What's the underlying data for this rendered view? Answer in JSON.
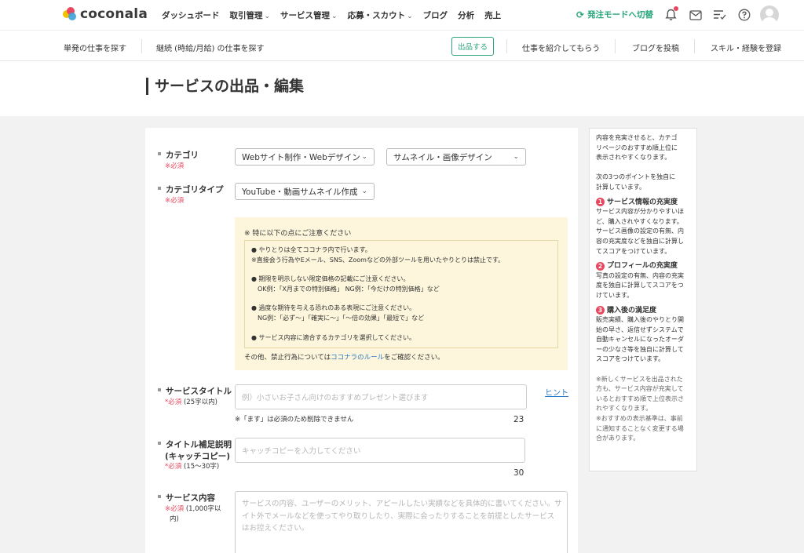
{
  "brand": {
    "name": "coconala"
  },
  "topnav": {
    "menu": [
      {
        "label": "ダッシュボード",
        "dropdown": false
      },
      {
        "label": "取引管理",
        "dropdown": true
      },
      {
        "label": "サービス管理",
        "dropdown": true
      },
      {
        "label": "応募・スカウト",
        "dropdown": true
      },
      {
        "label": "ブログ",
        "dropdown": false
      },
      {
        "label": "分析",
        "dropdown": false
      },
      {
        "label": "売上",
        "dropdown": false
      }
    ],
    "chevron": "⌄",
    "mode_switch": "発注モードへ切替",
    "icons": [
      "bell-icon",
      "mail-icon",
      "checklist-icon",
      "help-icon",
      "avatar"
    ],
    "accent_color": "#2aa57c",
    "badge_color": "#e9475f"
  },
  "subnav": {
    "left_links": [
      "単発の仕事を探す",
      "継続 (時給/月給) の仕事を探す"
    ],
    "publish_button": "出品する",
    "right_links": [
      "仕事を紹介してもらう",
      "ブログを投稿",
      "スキル・経験を登録"
    ]
  },
  "page": {
    "title": "サービスの出品・編集"
  },
  "form": {
    "category": {
      "label": "カテゴリ",
      "required": "※必須",
      "value1": "Webサイト制作・Webデザイン",
      "value2": "サムネイル・画像デザイン"
    },
    "category_type": {
      "label": "カテゴリタイプ",
      "required": "※必須",
      "value": "YouTube・動画サムネイル作成"
    },
    "notice": {
      "heading": "※ 特に以下の点にご注意ください",
      "lines": [
        "● やりとりは全てココナラ内で行います。",
        "※直接会う行為やEメール、SNS、Zoomなどの外部ツールを用いたやりとりは禁止です。",
        "● 期限を明示しない限定価格の記載にご注意ください。",
        "OK例：「X月までの特別価格」 NG例：「今だけの特別価格」など",
        "● 過度な期待を与える恐れのある表現にご注意ください。",
        "NG例：「必ず〜」「確実に〜」「〜倍の効果」「最短で」など",
        "● サービス内容に適合するカテゴリを選択してください。"
      ],
      "footer_prefix": "その他、禁止行為については",
      "footer_link": "ココナラのルール",
      "footer_suffix": "をご確認ください。"
    },
    "service_title": {
      "label": "サービスタイトル",
      "required": "*必須",
      "limit": "(25字以内)",
      "placeholder": "例）小さいお子さん向けのおすすめプレゼント選びます",
      "hint": "ヒント",
      "note": "※「ます」は必須のため削除できません",
      "counter": "23"
    },
    "catch_copy": {
      "label1": "タイトル補足説明",
      "label2": "(キャッチコピー)",
      "required": "*必須",
      "limit": "(15〜30字)",
      "placeholder": "キャッチコピーを入力してください",
      "counter": "30"
    },
    "service_content": {
      "label": "サービス内容",
      "required": "※必須",
      "limit1": "(1,000字以",
      "limit2": "内)",
      "placeholder_lines": [
        "サービスの内容、ユーザーのメリット、アピールしたい実績などを具体的に書いてください。サ",
        "イト外でメールなどを使ってやり取りしたり、実際に会ったりすることを前提としたサービス",
        "はお控えください。"
      ]
    }
  },
  "side_panel": {
    "intro": [
      "内容を充実させると、カテゴ",
      "リページのおすすめ順上位に",
      "表示されやすくなります。"
    ],
    "intro2": [
      "次の3つのポイントを独自に",
      "計算しています。"
    ],
    "points": [
      {
        "num": "1",
        "title": "サービス情報の充実度",
        "lines": [
          "サービス内容が分かりやすいほ",
          "ど、購入されやすくなります。",
          "サービス画像の設定の有無、内",
          "容の充実度などを独自に計算し",
          "てスコアをつけています。"
        ]
      },
      {
        "num": "2",
        "title": "プロフィールの充実度",
        "lines": [
          "写真の設定の有無、内容の充実",
          "度を独自に計算してスコアをつ",
          "けています。"
        ]
      },
      {
        "num": "3",
        "title": "購入後の満足度",
        "lines": [
          "販売実績、購入後のやりとり開",
          "始の早さ、返信せずシステムで",
          "自動キャンセルになったオーダ",
          "ーの少なさ等を独自に計算して",
          "スコアをつけています。"
        ]
      }
    ],
    "footnote": [
      "※新しくサービスを出品された",
      "方も、サービス内容が充実して",
      "いるとおすすめ順で上位表示さ",
      "れやすくなります。",
      "※おすすめの表示基準は、事前",
      "に通知することなく変更する場",
      "合があります。"
    ]
  }
}
